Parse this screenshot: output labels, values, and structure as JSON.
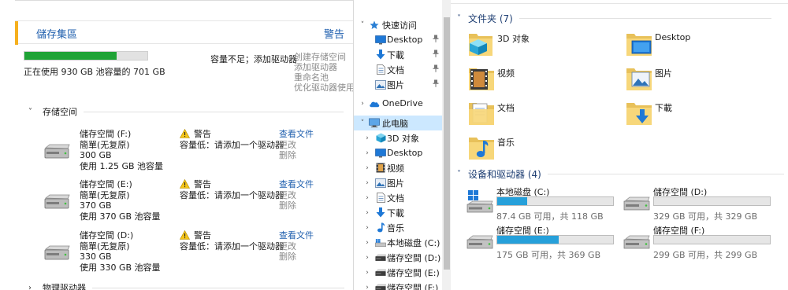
{
  "storage": {
    "pool_title": "儲存集區",
    "pool_warning": "警告",
    "pool_used_fraction": 0.75,
    "pool_usage_text": "正在使用 930 GB 池容量的 701 GB",
    "pool_status": "容量不足；添加驱动器",
    "pool_links": [
      "创建存储空间",
      "添加驱动器",
      "重命名池",
      "优化驱动器使用率"
    ],
    "section_spaces": "存储空间",
    "section_physical": "物理驱动器",
    "spaces": [
      {
        "name": "儲存空間 (F:)",
        "type": "簡單(无复原)",
        "size": "300 GB",
        "use": "使用 1.25 GB 池容量",
        "warn": "警告",
        "warn_detail": "容量低：请添加一个驱动器",
        "view": "查看文件",
        "change": "更改",
        "delete": "删除"
      },
      {
        "name": "儲存空間 (E:)",
        "type": "簡單(无复原)",
        "size": "370 GB",
        "use": "使用 370 GB 池容量",
        "warn": "警告",
        "warn_detail": "容量低：请添加一个驱动器",
        "view": "查看文件",
        "change": "更改",
        "delete": "删除"
      },
      {
        "name": "儲存空間 (D:)",
        "type": "簡單(无复原)",
        "size": "330 GB",
        "use": "使用 330 GB 池容量",
        "warn": "警告",
        "warn_detail": "容量低：请添加一个驱动器",
        "view": "查看文件",
        "change": "更改",
        "delete": "删除"
      }
    ]
  },
  "nav": {
    "items": [
      {
        "label": "快速访问",
        "icon": "star-icon",
        "expander": "˅",
        "pin": ""
      },
      {
        "label": "Desktop",
        "icon": "desktop-icon",
        "expander": "",
        "pin": "📌"
      },
      {
        "label": "下載",
        "icon": "download-arrow-icon",
        "expander": "",
        "pin": "📌"
      },
      {
        "label": "文档",
        "icon": "document-icon",
        "expander": "",
        "pin": "📌"
      },
      {
        "label": "图片",
        "icon": "picture-icon",
        "expander": "",
        "pin": "📌"
      },
      {
        "label": "OneDrive",
        "icon": "cloud-icon",
        "expander": "›",
        "pin": ""
      },
      {
        "label": "此电脑",
        "icon": "computer-icon",
        "expander": "˅",
        "pin": ""
      },
      {
        "label": "3D 对象",
        "icon": "cube-icon",
        "expander": "›",
        "pin": ""
      },
      {
        "label": "Desktop",
        "icon": "desktop-icon",
        "expander": "›",
        "pin": ""
      },
      {
        "label": "视频",
        "icon": "film-icon",
        "expander": "›",
        "pin": ""
      },
      {
        "label": "图片",
        "icon": "picture-icon",
        "expander": "›",
        "pin": ""
      },
      {
        "label": "文档",
        "icon": "document-icon",
        "expander": "›",
        "pin": ""
      },
      {
        "label": "下載",
        "icon": "download-arrow-icon",
        "expander": "›",
        "pin": ""
      },
      {
        "label": "音乐",
        "icon": "music-icon",
        "expander": "›",
        "pin": ""
      },
      {
        "label": "本地磁盘 (C:)",
        "icon": "windows-drive-icon",
        "expander": "›",
        "pin": ""
      },
      {
        "label": "儲存空間 (D:)",
        "icon": "drive-icon",
        "expander": "›",
        "pin": ""
      },
      {
        "label": "儲存空間 (E:)",
        "icon": "drive-icon",
        "expander": "›",
        "pin": ""
      },
      {
        "label": "儲存空間 (F:)",
        "icon": "drive-icon",
        "expander": "›",
        "pin": ""
      }
    ]
  },
  "content": {
    "folders_header": "文件夹 (7)",
    "folders": [
      {
        "name": "3D 对象",
        "icon": "cube-folder-icon"
      },
      {
        "name": "Desktop",
        "icon": "desktop-folder-icon"
      },
      {
        "name": "视频",
        "icon": "video-folder-icon"
      },
      {
        "name": "图片",
        "icon": "picture-folder-icon"
      },
      {
        "name": "文档",
        "icon": "document-folder-icon"
      },
      {
        "name": "下載",
        "icon": "download-folder-icon"
      },
      {
        "name": "音乐",
        "icon": "music-folder-icon"
      }
    ],
    "devices_header": "设备和驱动器 (4)",
    "devices": [
      {
        "name": "本地磁盘 (C:)",
        "free": "87.4 GB 可用，共 118 GB",
        "used_fraction": 0.26,
        "icon": "windows-drive-icon"
      },
      {
        "name": "儲存空間 (D:)",
        "free": "329 GB 可用，共 329 GB",
        "used_fraction": 0.0,
        "icon": "drive-icon"
      },
      {
        "name": "儲存空間 (E:)",
        "free": "175 GB 可用，共 369 GB",
        "used_fraction": 0.53,
        "icon": "drive-icon"
      },
      {
        "name": "儲存空間 (F:)",
        "free": "299 GB 可用，共 299 GB",
        "used_fraction": 0.0,
        "icon": "drive-icon"
      }
    ]
  },
  "colors": {
    "accent": "#f6b01e",
    "link": "#1f5fae",
    "pool_bar": "#1fa336",
    "drive_bar": "#26a0da",
    "selection": "#cce8ff"
  }
}
